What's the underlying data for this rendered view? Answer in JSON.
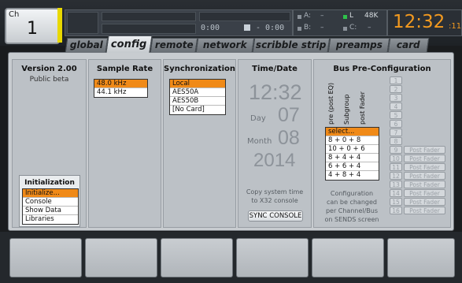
{
  "channel": {
    "label": "Ch",
    "number": "1"
  },
  "transport": {
    "time_left": "0:00",
    "time_right": "- 0:00"
  },
  "status": {
    "a_label": "A:",
    "a_value": "–",
    "b_label": "B:",
    "b_value": "–",
    "l_label": "L",
    "rate": "48K",
    "c_label": "C:",
    "c_value": "–"
  },
  "clock": {
    "hm": "12:32",
    "sec": ":11"
  },
  "tabs": [
    "global",
    "config",
    "remote",
    "network",
    "scribble strip",
    "preamps",
    "card"
  ],
  "version": {
    "title": "Version 2.00",
    "subtitle": "Public beta"
  },
  "initialization": {
    "title": "Initialization",
    "items": [
      "Initialize...",
      "Console",
      "Show Data",
      "Libraries"
    ]
  },
  "sample_rate": {
    "title": "Sample Rate",
    "items": [
      "48.0 kHz",
      "44.1 kHz"
    ]
  },
  "sync": {
    "title": "Synchronization",
    "items": [
      "Local",
      "AES50A",
      "AES50B",
      "[No Card]"
    ]
  },
  "timedate": {
    "title": "Time/Date",
    "time": "12:32",
    "day_label": "Day",
    "day": "07",
    "month_label": "Month",
    "month": "08",
    "year": "2014",
    "copy_text_1": "Copy system time",
    "copy_text_2": "to X32 console",
    "sync_button": "SYNC CONSOLE"
  },
  "bus": {
    "title": "Bus Pre-Configuration",
    "vertical_labels": [
      "pre (post EQ)",
      "Subgroup",
      "post Fader"
    ],
    "options": [
      "select...",
      "8 + 0 + 8",
      "10 + 0 + 6",
      "8 + 4 + 4",
      "6 + 6 + 4",
      "4 + 8 + 4"
    ],
    "note": [
      "Configuration",
      "can be changed",
      "per Channel/Bus",
      "on SENDS screen"
    ],
    "numbers": [
      "1",
      "2",
      "3",
      "4",
      "5",
      "6",
      "7",
      "8",
      "9",
      "10",
      "11",
      "12",
      "13",
      "14",
      "15",
      "16"
    ],
    "post_fader_label": "Post Fader"
  },
  "colors": {
    "accent": "#f08a18",
    "channel_strip": "#e8d800",
    "clock": "#f39a1f",
    "status_green": "#2ec24a"
  }
}
